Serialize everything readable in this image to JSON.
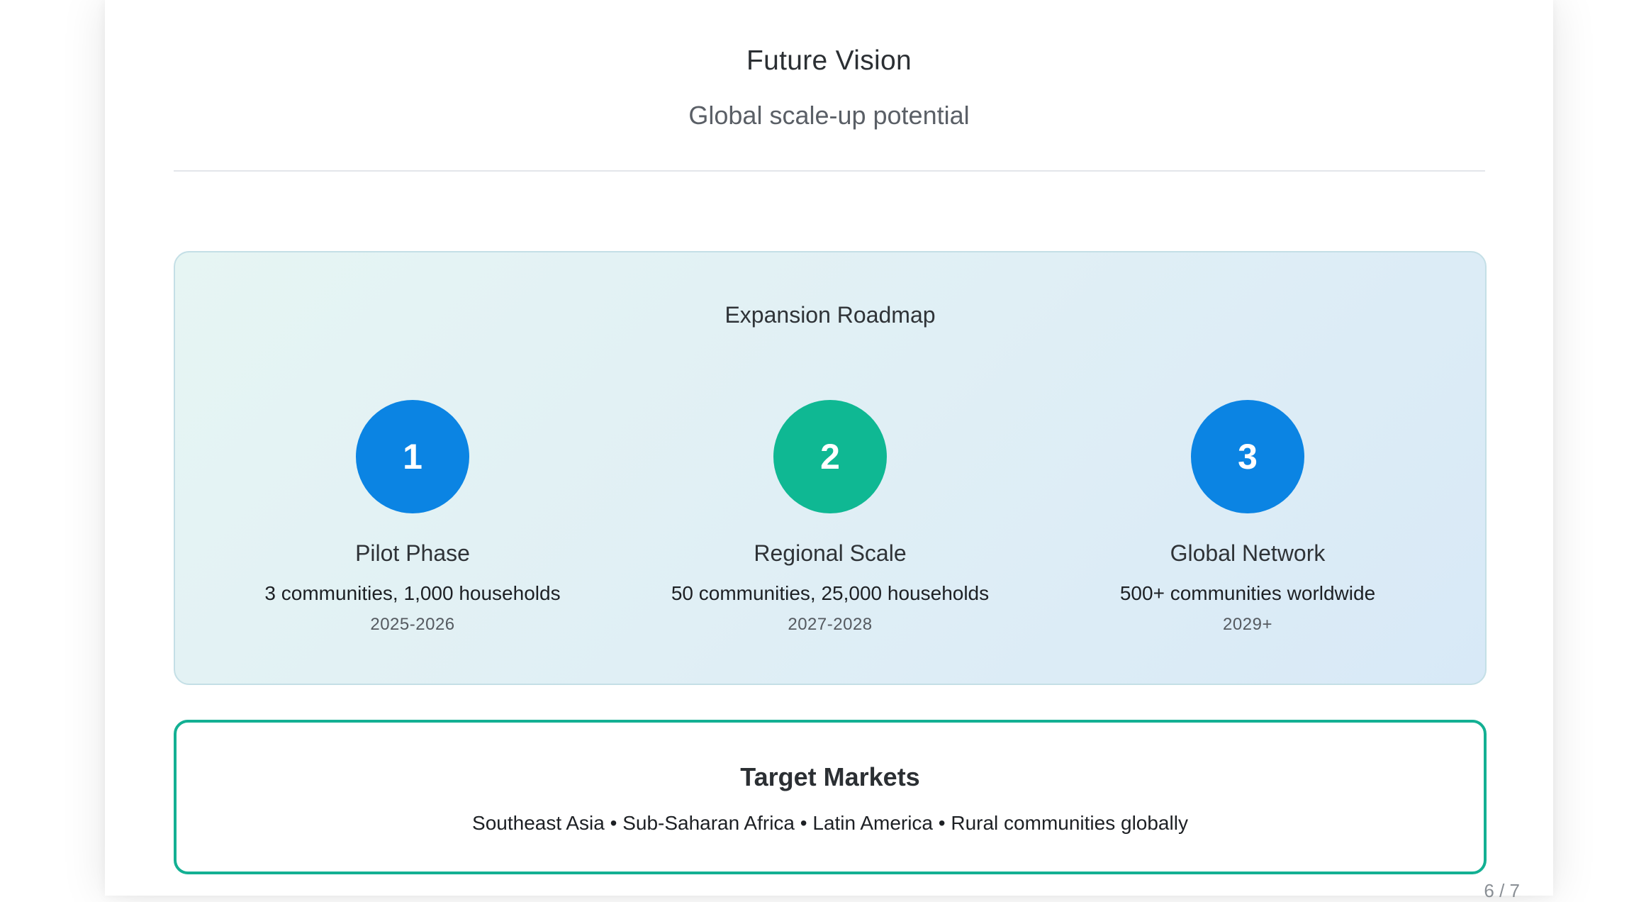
{
  "slide": {
    "title": "Future Vision",
    "subtitle": "Global scale-up potential",
    "page_indicator": "6 / 7"
  },
  "roadmap": {
    "heading": "Expansion Roadmap",
    "stages": [
      {
        "number": "1",
        "name": "Pilot Phase",
        "description": "3 communities, 1,000 households",
        "years": "2025-2026",
        "color": "#0b84e3"
      },
      {
        "number": "2",
        "name": "Regional Scale",
        "description": "50 communities, 25,000 households",
        "years": "2027-2028",
        "color": "#0fb893"
      },
      {
        "number": "3",
        "name": "Global Network",
        "description": "500+ communities worldwide",
        "years": "2029+",
        "color": "#0b84e3"
      }
    ]
  },
  "target_markets": {
    "heading": "Target Markets",
    "list": "Southeast Asia • Sub-Saharan Africa • Latin America • Rural communities globally"
  },
  "colors": {
    "accent_blue": "#0b84e3",
    "accent_green": "#0fb893",
    "border_green": "#13b093"
  }
}
